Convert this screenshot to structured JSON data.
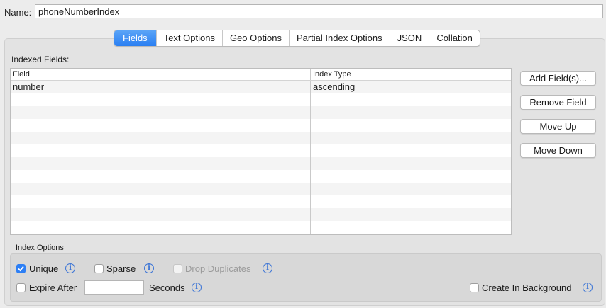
{
  "name": {
    "label": "Name:",
    "value": "phoneNumberIndex"
  },
  "tabs": [
    {
      "label": "Fields",
      "active": true
    },
    {
      "label": "Text Options"
    },
    {
      "label": "Geo Options"
    },
    {
      "label": "Partial Index Options"
    },
    {
      "label": "JSON"
    },
    {
      "label": "Collation"
    }
  ],
  "indexed_fields": {
    "label": "Indexed Fields:",
    "columns": [
      "Field",
      "Index Type"
    ],
    "rows": [
      {
        "field": "number",
        "type": "ascending"
      }
    ]
  },
  "buttons": {
    "add": "Add Field(s)...",
    "remove": "Remove Field",
    "move_up": "Move Up",
    "move_down": "Move Down"
  },
  "index_options": {
    "label": "Index Options",
    "unique": {
      "label": "Unique",
      "checked": true
    },
    "sparse": {
      "label": "Sparse",
      "checked": false
    },
    "drop_duplicates": {
      "label": "Drop Duplicates",
      "checked": false,
      "disabled": true
    },
    "expire_after": {
      "label": "Expire After",
      "checked": false,
      "value": "",
      "unit": "Seconds"
    },
    "create_in_background": {
      "label": "Create In Background",
      "checked": false
    }
  },
  "info_glyph": "i",
  "colors": {
    "accent": "#2d7ff5",
    "info": "#3b74d6"
  }
}
